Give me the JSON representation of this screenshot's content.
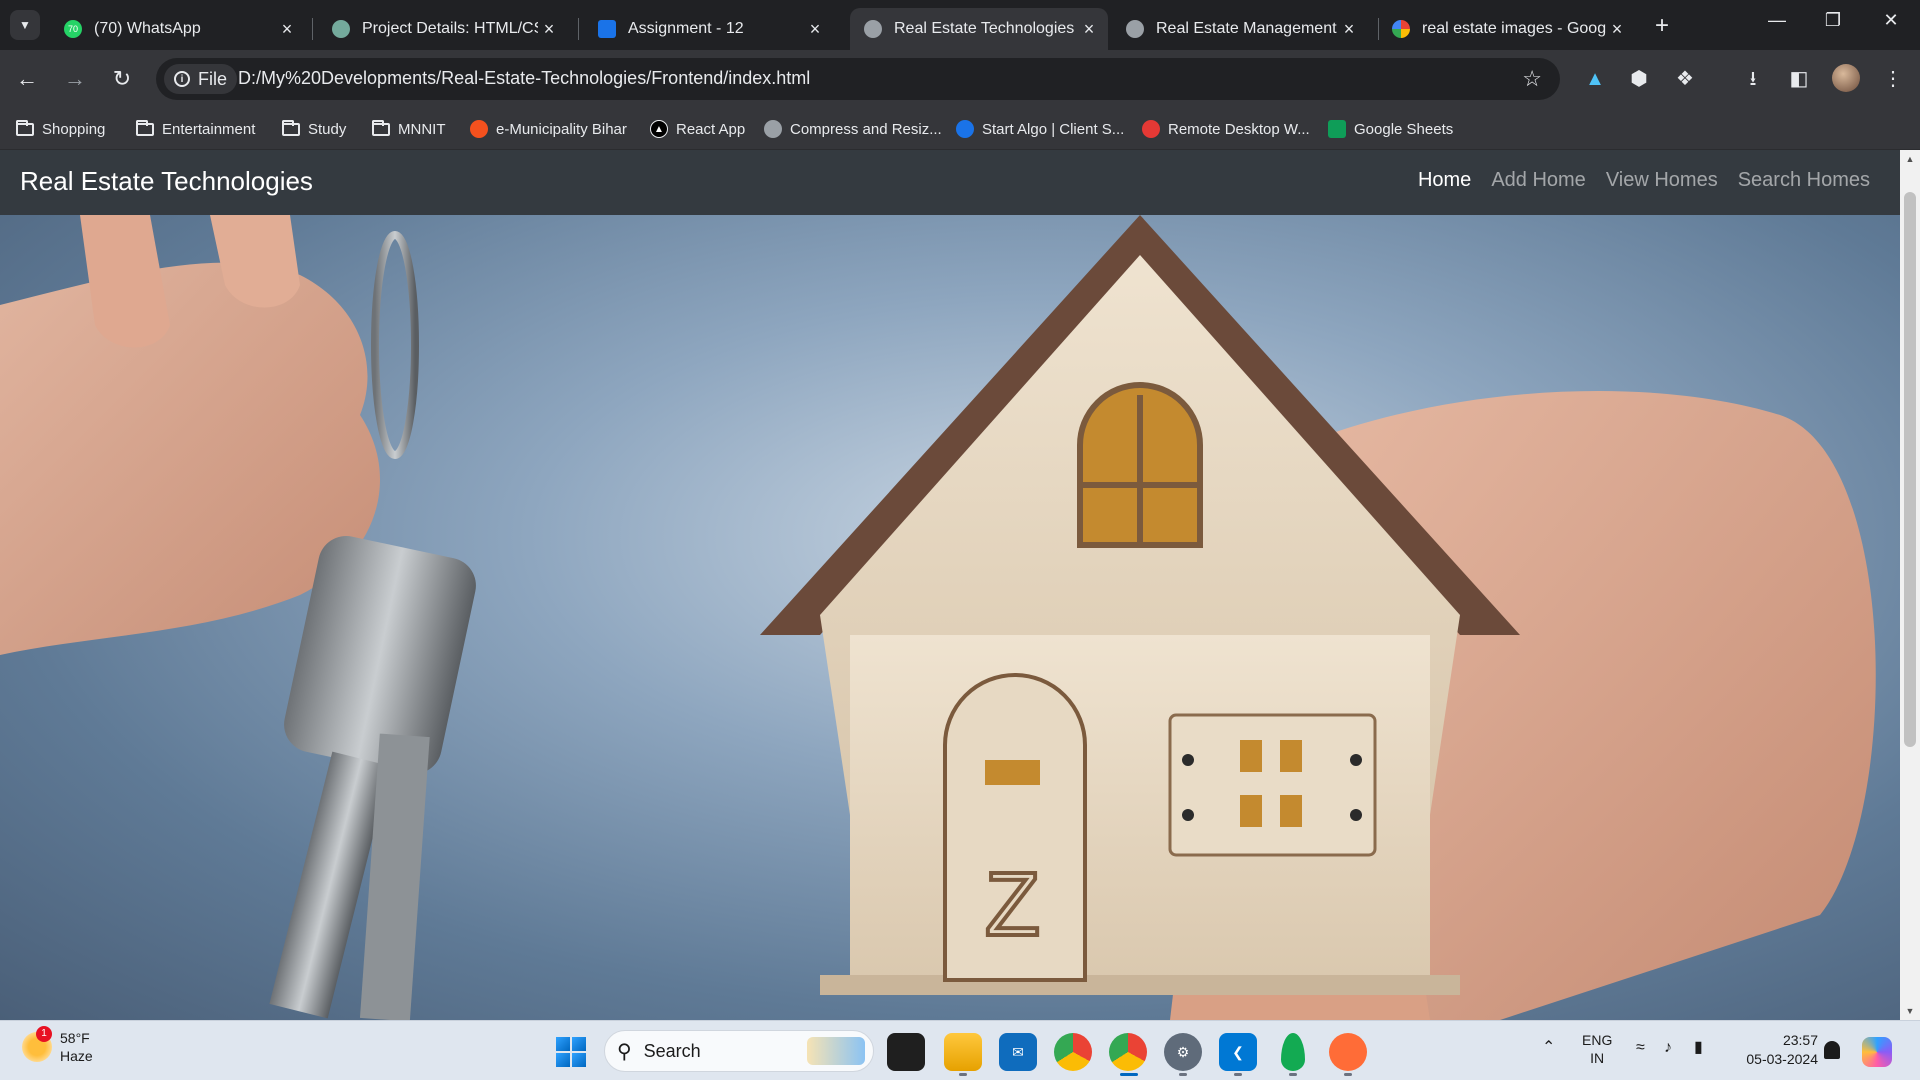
{
  "browser": {
    "tabs": [
      {
        "title": "(70) WhatsApp",
        "icon": "whatsapp-icon",
        "badge": "70",
        "color": "#25d366"
      },
      {
        "title": "Project Details: HTML/CSS/",
        "icon": "chatgpt-icon",
        "color": "#74aa9c"
      },
      {
        "title": "Assignment - 12",
        "icon": "classroom-icon",
        "color": "#1a73e8"
      },
      {
        "title": "Real Estate Technologies",
        "icon": "globe-icon",
        "active": true
      },
      {
        "title": "Real Estate Management S",
        "icon": "globe-icon"
      },
      {
        "title": "real estate images - Googl",
        "icon": "google-icon"
      }
    ],
    "omnibox": {
      "scheme_label": "File",
      "url": "D:/My%20Developments/Real-Estate-Technologies/Frontend/index.html"
    },
    "bookmarks": [
      {
        "label": "Shopping",
        "icon": "folder-icon"
      },
      {
        "label": "Entertainment",
        "icon": "folder-icon"
      },
      {
        "label": "Study",
        "icon": "folder-icon"
      },
      {
        "label": "MNNIT",
        "icon": "folder-icon"
      },
      {
        "label": "e-Municipality Bihar",
        "icon": "emunicipality-icon",
        "color": "#f4511e"
      },
      {
        "label": "React App",
        "icon": "react-icon",
        "color": "#000000"
      },
      {
        "label": "Compress and Resiz...",
        "icon": "globe-icon",
        "color": "#9aa0a6"
      },
      {
        "label": "Start Algo | Client S...",
        "icon": "startalgo-icon",
        "color": "#1a73e8"
      },
      {
        "label": "Remote Desktop W...",
        "icon": "remote-desktop-icon",
        "color": "#e53935"
      },
      {
        "label": "Google Sheets",
        "icon": "sheets-icon",
        "color": "#0f9d58"
      }
    ]
  },
  "site": {
    "brand": "Real Estate Technologies",
    "nav": [
      "Home",
      "Add Home",
      "View Homes",
      "Search Homes"
    ],
    "active_nav": "Home",
    "navbar_color": "#343a40"
  },
  "taskbar": {
    "weather": {
      "temp": "58°F",
      "condition": "Haze",
      "badge": "1"
    },
    "search_placeholder": "Search",
    "language": {
      "line1": "ENG",
      "line2": "IN"
    },
    "clock": {
      "time": "23:57",
      "date": "05-03-2024"
    },
    "apps": [
      "file-explorer-icon",
      "task-view-icon",
      "folder-icon",
      "mail-icon",
      "chrome-icon",
      "chrome-icon",
      "settings-icon",
      "vscode-icon",
      "mongodb-icon",
      "postman-icon"
    ]
  }
}
